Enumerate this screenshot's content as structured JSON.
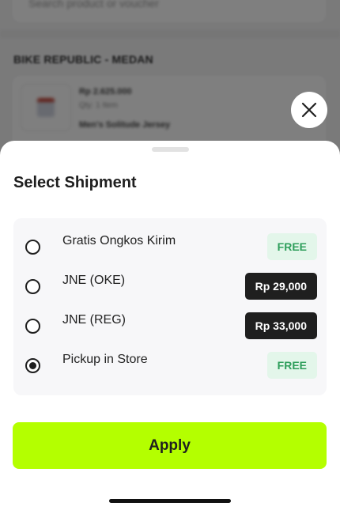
{
  "background": {
    "search_text": "Search product or voucher",
    "store_name": "BIKE REPUBLIC  - MEDAN",
    "product": {
      "price": "Rp 2.625.000",
      "qty": "Qty: 1 Item",
      "name": "Men's Solitude Jersey"
    }
  },
  "sheet": {
    "title": "Select Shipment",
    "options": [
      {
        "label": "Gratis Ongkos Kirim",
        "price": "FREE",
        "selected": false
      },
      {
        "label": "JNE (OKE)",
        "price": "Rp 29,000",
        "selected": false
      },
      {
        "label": "JNE (REG)",
        "price": "Rp 33,000",
        "selected": false
      },
      {
        "label": "Pickup in Store",
        "price": "FREE",
        "selected": true
      }
    ],
    "apply_label": "Apply"
  },
  "colors": {
    "accent": "#b4ff00",
    "free_badge_bg": "#e3f6ea",
    "free_badge_text": "#2e9e5b",
    "paid_badge_bg": "#1f1f1f"
  },
  "icons": {
    "close": "close-icon"
  }
}
